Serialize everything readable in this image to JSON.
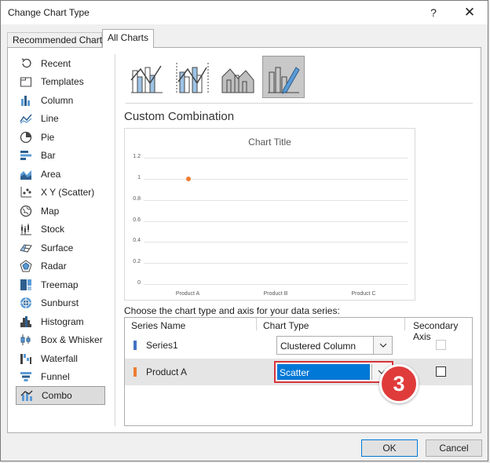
{
  "window": {
    "title": "Change Chart Type",
    "help_glyph": "?",
    "close_glyph": "✕"
  },
  "tabs": [
    {
      "label": "Recommended Charts",
      "active": false
    },
    {
      "label": "All Charts",
      "active": true
    }
  ],
  "chart_types": [
    {
      "label": "Recent",
      "icon": "recent-icon"
    },
    {
      "label": "Templates",
      "icon": "templates-icon"
    },
    {
      "label": "Column",
      "icon": "column-chart-icon"
    },
    {
      "label": "Line",
      "icon": "line-chart-icon"
    },
    {
      "label": "Pie",
      "icon": "pie-chart-icon"
    },
    {
      "label": "Bar",
      "icon": "bar-chart-icon"
    },
    {
      "label": "Area",
      "icon": "area-chart-icon"
    },
    {
      "label": "X Y (Scatter)",
      "icon": "scatter-chart-icon"
    },
    {
      "label": "Map",
      "icon": "map-chart-icon"
    },
    {
      "label": "Stock",
      "icon": "stock-chart-icon"
    },
    {
      "label": "Surface",
      "icon": "surface-chart-icon"
    },
    {
      "label": "Radar",
      "icon": "radar-chart-icon"
    },
    {
      "label": "Treemap",
      "icon": "treemap-chart-icon"
    },
    {
      "label": "Sunburst",
      "icon": "sunburst-chart-icon"
    },
    {
      "label": "Histogram",
      "icon": "histogram-chart-icon"
    },
    {
      "label": "Box & Whisker",
      "icon": "box-whisker-chart-icon"
    },
    {
      "label": "Waterfall",
      "icon": "waterfall-chart-icon"
    },
    {
      "label": "Funnel",
      "icon": "funnel-chart-icon"
    },
    {
      "label": "Combo",
      "icon": "combo-chart-icon",
      "selected": true
    }
  ],
  "subtypes": [
    {
      "name": "clustered-column-line",
      "selected": false
    },
    {
      "name": "clustered-column-line-secondary-axis",
      "selected": false
    },
    {
      "name": "stacked-area-clustered-column",
      "selected": false
    },
    {
      "name": "custom-combination",
      "selected": true
    }
  ],
  "section_title": "Custom Combination",
  "preview": {
    "title": "Chart Title"
  },
  "chart_data": {
    "type": "scatter",
    "title": "Chart Title",
    "categories": [
      "Product A",
      "Product B",
      "Product C"
    ],
    "ylim": [
      0,
      1.2
    ],
    "yticks": [
      "0",
      "0.2",
      "0.4",
      "0.6",
      "0.8",
      "1",
      "1.2"
    ],
    "grid": true,
    "series": [
      {
        "name": "Product A",
        "type": "scatter",
        "color": "#ed7d31",
        "points": [
          {
            "x": 1,
            "y": 1
          }
        ]
      }
    ]
  },
  "series_config": {
    "prompt": "Choose the chart type and axis for your data series:",
    "headers": {
      "name": "Series Name",
      "type": "Chart Type",
      "axis": "Secondary Axis"
    },
    "rows": [
      {
        "name": "Series1",
        "color": "#4472c4",
        "chart_type": "Clustered Column",
        "secondary_axis": false,
        "axis_enabled": false,
        "selected": false
      },
      {
        "name": "Product A",
        "color": "#ed7d31",
        "chart_type": "Scatter",
        "secondary_axis": false,
        "axis_enabled": true,
        "selected": true
      }
    ]
  },
  "annotation": {
    "step": "3",
    "color": "#e03b3b"
  },
  "buttons": {
    "ok": "OK",
    "cancel": "Cancel"
  }
}
